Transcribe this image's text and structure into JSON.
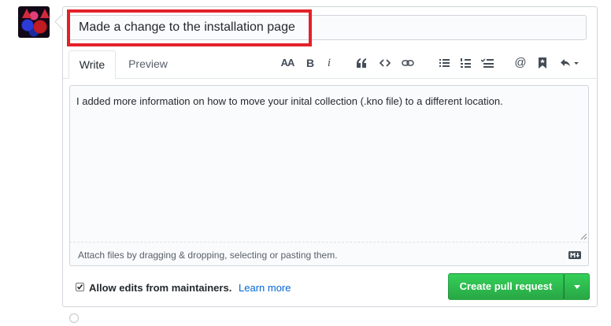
{
  "title_input": {
    "value": "Made a change to the installation page"
  },
  "tabs": [
    {
      "label": "Write"
    },
    {
      "label": "Preview"
    }
  ],
  "toolbar": {
    "icons": [
      "text-size-icon",
      "bold-icon",
      "italic-icon",
      "quote-icon",
      "code-icon",
      "link-icon",
      "bulleted-list-icon",
      "numbered-list-icon",
      "task-list-icon",
      "mention-icon",
      "bookmark-icon",
      "reply-icon"
    ],
    "text_size_label": "AA",
    "bold_label": "B",
    "italic_label": "i",
    "mention_label": "@"
  },
  "editor": {
    "body": "I added more information on how to move your inital collection (.kno file) to a different location."
  },
  "attach": {
    "hint": "Attach files by dragging & dropping, selecting or pasting them."
  },
  "options": {
    "allow_edits_label": "Allow edits from maintainers.",
    "allow_edits_checked": true,
    "learn_more": "Learn more"
  },
  "actions": {
    "create_pr_label": "Create pull request"
  },
  "colors": {
    "primary_button": "#2ea44f",
    "link": "#0366d6",
    "highlight": "#e3212b"
  }
}
